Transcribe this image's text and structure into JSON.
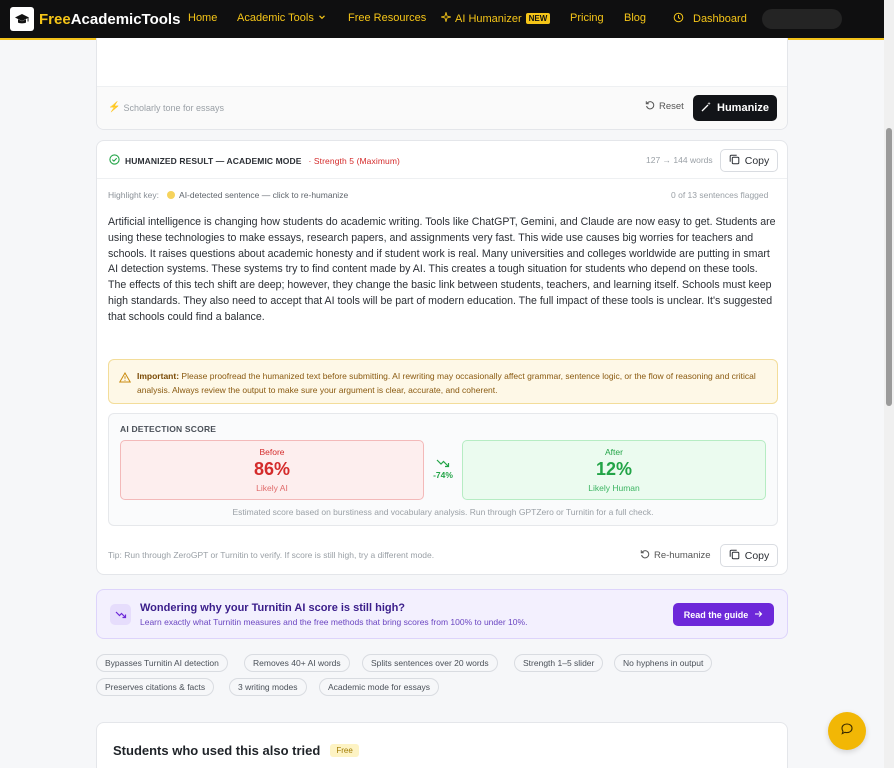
{
  "nav": {
    "brand_free": "Free",
    "brand_rest": "AcademicTools",
    "items": [
      {
        "label": "Home"
      },
      {
        "label": "Academic Tools"
      },
      {
        "label": "Free Resources"
      },
      {
        "label": "AI Humanizer",
        "badge": "NEW"
      },
      {
        "label": "Pricing"
      },
      {
        "label": "Blog"
      },
      {
        "label": "Dashboard"
      }
    ]
  },
  "editor": {
    "tone_label": "Scholarly tone for essays",
    "reset_label": "Reset",
    "humanize_label": "Humanize"
  },
  "result": {
    "title": "HUMANIZED RESULT — ACADEMIC MODE",
    "strength": "· Strength 5 (Maximum)",
    "word_count": "127 → 144 words",
    "copy_label": "Copy",
    "highlight_key_label": "Highlight key:",
    "highlight_key_desc": "AI-detected sentence — click to re-humanize",
    "flagged": "0 of 13 sentences flagged",
    "text": "Artificial intelligence is changing how students do academic writing. Tools like ChatGPT, Gemini, and Claude are now easy to get. Students are using these technologies to make essays, research papers, and assignments very fast. This wide use causes big worries for teachers and schools. It raises questions about academic honesty and if student work is real. Many universities and colleges worldwide are putting in smart AI detection systems. These systems try to find content made by AI. This creates a tough situation for students who depend on these tools. The effects of this tech shift are deep; however, they change the basic link between students, teachers, and learning itself. Schools must keep high standards. They also need to accept that AI tools will be part of modern education. The full impact of these tools is unclear. It's suggested that schools could find a balance.",
    "warning_bold": "Important:",
    "warning_text": "Please proofread the humanized text before submitting. AI rewriting may occasionally affect grammar, sentence logic, or the flow of reasoning and critical analysis. Always review the output to make sure your argument is clear, accurate, and coherent.",
    "detection": {
      "label": "AI DETECTION SCORE",
      "before_label": "Before",
      "before_value": "86%",
      "before_sub": "Likely AI",
      "delta": "-74%",
      "after_label": "After",
      "after_value": "12%",
      "after_sub": "Likely Human",
      "note": "Estimated score based on burstiness and vocabulary analysis. Run through GPTZero or Turnitin for a full check."
    },
    "tip": "Tip: Run through ZeroGPT or Turnitin to verify. If score is still high, try a different mode.",
    "rehumanize_label": "Re-humanize",
    "copy_label_2": "Copy"
  },
  "banner": {
    "title": "Wondering why your Turnitin AI score is still high?",
    "subtitle": "Learn exactly what Turnitin measures and the free methods that bring scores from 100% to under 10%.",
    "button": "Read the guide"
  },
  "features": [
    "Bypasses Turnitin AI detection",
    "Removes 40+ AI words",
    "Splits sentences over 20 words",
    "Strength 1–5 slider",
    "No hyphens in output",
    "Preserves citations & facts",
    "3 writing modes",
    "Academic mode for essays"
  ],
  "also_tried": {
    "title": "Students who used this also tried",
    "badge": "Free"
  },
  "colors": {
    "brand_yellow": "#f5c518",
    "danger": "#d42b2b",
    "success": "#22a447",
    "accent_purple": "#6d28d9"
  }
}
